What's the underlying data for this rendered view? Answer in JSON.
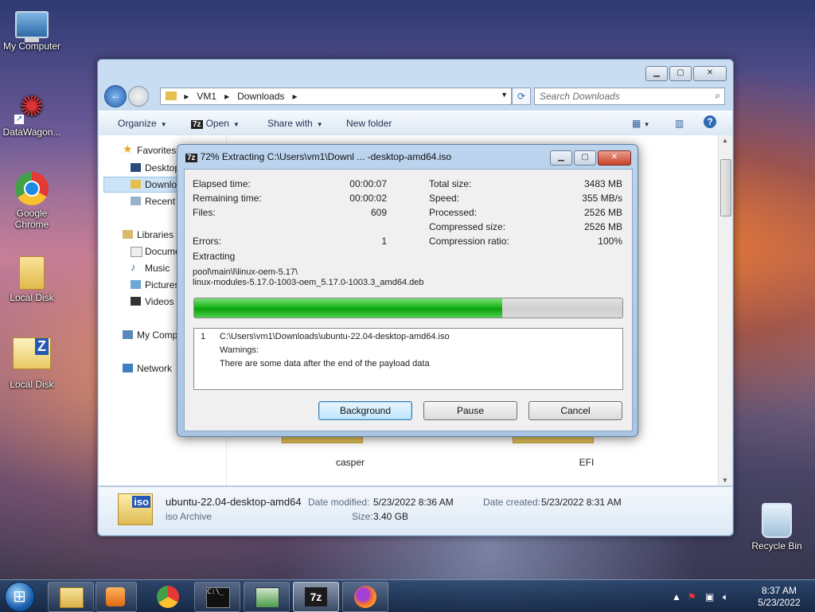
{
  "desktop": {
    "icons": [
      {
        "label": "My Computer"
      },
      {
        "label": "DataWagon..."
      },
      {
        "label": "Google Chrome"
      },
      {
        "label": "Local Disk"
      },
      {
        "label": "Local Disk"
      },
      {
        "label": "Recycle Bin"
      }
    ]
  },
  "explorer": {
    "breadcrumb": [
      "VM1",
      "Downloads"
    ],
    "search_placeholder": "Search Downloads",
    "toolbar": {
      "organize": "Organize",
      "open": "Open",
      "share_with": "Share with",
      "new_folder": "New folder"
    },
    "nav": {
      "favorites": "Favorites",
      "desktop": "Desktop",
      "downloads": "Downloads",
      "recent": "Recent Places",
      "libraries": "Libraries",
      "documents": "Documents",
      "music": "Music",
      "pictures": "Pictures",
      "videos": "Videos",
      "computer": "My Computer",
      "network": "Network"
    },
    "folders": [
      {
        "label": "casper"
      },
      {
        "label": "EFI"
      }
    ],
    "details": {
      "icon_text": "iso",
      "filename": "ubuntu-22.04-desktop-amd64",
      "type": "iso Archive",
      "date_modified_label": "Date modified:",
      "date_modified": "5/23/2022 8:36 AM",
      "date_created_label": "Date created:",
      "date_created": "5/23/2022 8:31 AM",
      "size_label": "Size:",
      "size": "3.40 GB"
    }
  },
  "dialog": {
    "title": "72% Extracting C:\\Users\\vm1\\Downl ... -desktop-amd64.iso",
    "left": {
      "elapsed_label": "Elapsed time:",
      "elapsed": "00:00:07",
      "remaining_label": "Remaining time:",
      "remaining": "00:00:02",
      "files_label": "Files:",
      "files": "609",
      "errors_label": "Errors:",
      "errors": "1"
    },
    "right": {
      "total_label": "Total size:",
      "total": "3483 MB",
      "speed_label": "Speed:",
      "speed": "355 MB/s",
      "processed_label": "Processed:",
      "processed": "2526 MB",
      "compressed_label": "Compressed size:",
      "compressed": "2526 MB",
      "ratio_label": "Compression ratio:",
      "ratio": "100%"
    },
    "status": "Extracting",
    "path_line1": "pool\\main\\l\\linux-oem-5.17\\",
    "path_line2": "linux-modules-5.17.0-1003-oem_5.17.0-1003.3_amd64.deb",
    "progress_fraction": 0.72,
    "log": {
      "index": "1",
      "path": "C:\\Users\\vm1\\Downloads\\ubuntu-22.04-desktop-amd64.iso",
      "warnings": "Warnings:",
      "message": "There are some data after the end of the payload data"
    },
    "buttons": {
      "background": "Background",
      "pause": "Pause",
      "cancel": "Cancel"
    }
  },
  "taskbar": {
    "time": "8:37 AM",
    "date": "5/23/2022",
    "apps": [
      "explorer-icon",
      "media-player-icon",
      "chrome-icon",
      "cmd-icon",
      "network-manager-icon",
      "7zip-icon",
      "firefox-icon"
    ]
  }
}
